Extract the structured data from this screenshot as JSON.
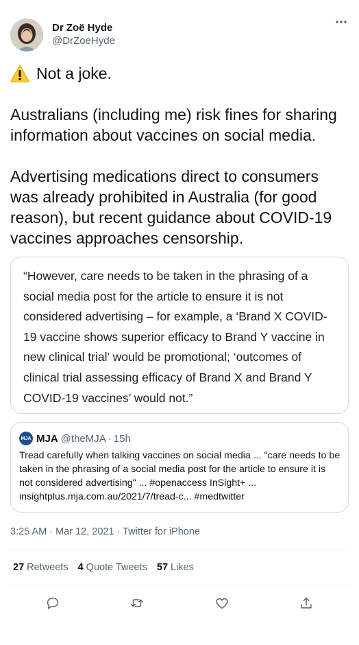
{
  "author": {
    "name": "Dr Zoë Hyde",
    "handle": "@DrZoeHyde"
  },
  "tweet": {
    "line1": "Not a joke.",
    "paragraph2": "Australians (including me) risk fines for sharing information about vaccines on social media.",
    "paragraph3": "Advertising medications direct to consumers was already prohibited in Australia (for good reason), but recent guidance about COVID-19 vaccines approaches censorship."
  },
  "image_quote": {
    "text": "“However, care needs to be taken in the phrasing of a social media post for the article to ensure it is not considered advertising – for example, a ‘Brand X COVID-19 vaccine shows superior efficacy to Brand Y vaccine in new clinical trial’ would be promotional; ‘outcomes of clinical trial assessing efficacy of Brand X and Brand Y COVID-19 vaccines’ would not.”"
  },
  "quoted_tweet": {
    "avatar_text": "MJA",
    "name": "MJA",
    "handle": "@theMJA",
    "separator": "·",
    "time": "15h",
    "text": "Tread carefully when talking vaccines on social media ... \"care needs to be taken in the phrasing of a social media post for the article to ensure it is not considered advertising\" ... #openaccess InSight+ ... insightplus.mja.com.au/2021/7/tread-c... #medtwitter"
  },
  "meta": {
    "timestamp": "3:25 AM · Mar 12, 2021 · Twitter for iPhone"
  },
  "stats": {
    "retweets_count": "27",
    "retweets_label": "Retweets",
    "quotes_count": "4",
    "quotes_label": "Quote Tweets",
    "likes_count": "57",
    "likes_label": "Likes"
  },
  "icons": {
    "more": "more-options-icon",
    "warning": "warning-icon",
    "reply": "reply-icon",
    "retweet": "retweet-icon",
    "like": "like-icon",
    "share": "share-icon"
  },
  "colors": {
    "text": "#0f1419",
    "secondary": "#536471",
    "border": "#cfd9de",
    "warning": "#ffcc32"
  }
}
